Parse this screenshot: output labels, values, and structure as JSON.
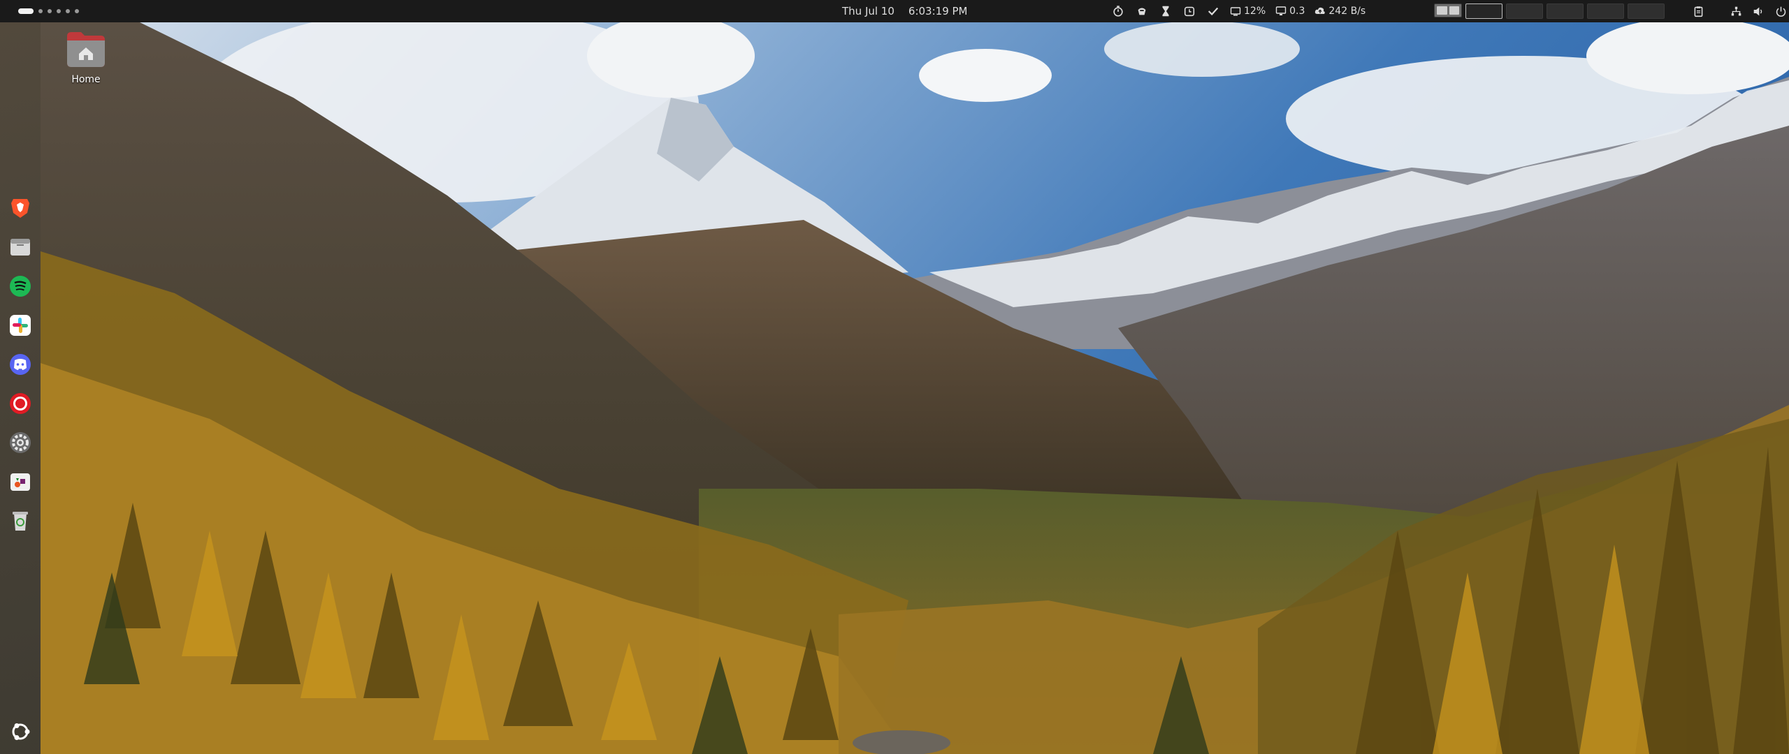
{
  "top_panel": {
    "date": "Thu Jul 10",
    "time": "6:03:19 PM",
    "cpu": "12%",
    "load": "0.3",
    "net": "242 B/s"
  },
  "desktop": {
    "home_label": "Home"
  },
  "dock": {
    "apps": [
      "brave-browser",
      "files",
      "spotify",
      "slack",
      "discord",
      "screen-recorder",
      "settings",
      "app-center",
      "trash"
    ],
    "show_apps": "show-apps"
  },
  "colors": {
    "panel": "#1a1a1a",
    "brave": "#fb542b",
    "spotify": "#1db954",
    "discord": "#5865f2",
    "recorder": "#e01b24"
  }
}
